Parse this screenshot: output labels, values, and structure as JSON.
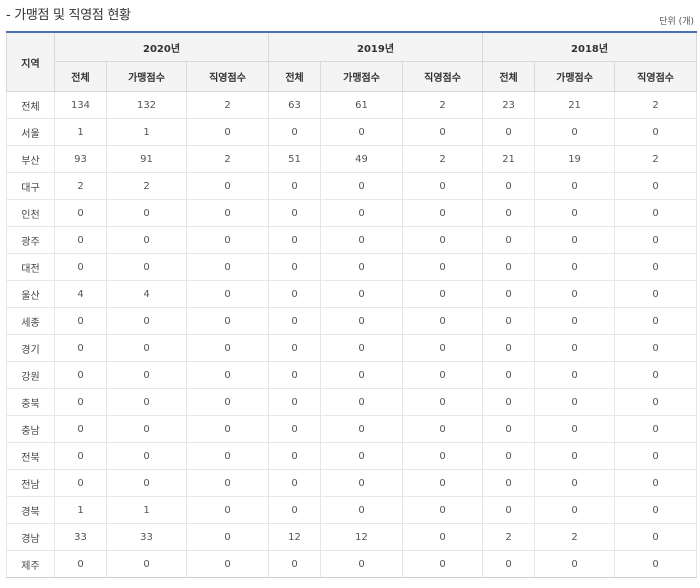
{
  "title": "- 가맹점 및 직영점 현황",
  "unit": "단위 (개)",
  "table": {
    "region_header": "지역",
    "years": [
      "2020년",
      "2019년",
      "2018년"
    ],
    "subheaders": [
      "전체",
      "가맹점수",
      "직영점수"
    ],
    "rows": [
      {
        "region": "전체",
        "values": [
          "134",
          "132",
          "2",
          "63",
          "61",
          "2",
          "23",
          "21",
          "2"
        ]
      },
      {
        "region": "서울",
        "values": [
          "1",
          "1",
          "0",
          "0",
          "0",
          "0",
          "0",
          "0",
          "0"
        ]
      },
      {
        "region": "부산",
        "values": [
          "93",
          "91",
          "2",
          "51",
          "49",
          "2",
          "21",
          "19",
          "2"
        ]
      },
      {
        "region": "대구",
        "values": [
          "2",
          "2",
          "0",
          "0",
          "0",
          "0",
          "0",
          "0",
          "0"
        ]
      },
      {
        "region": "인천",
        "values": [
          "0",
          "0",
          "0",
          "0",
          "0",
          "0",
          "0",
          "0",
          "0"
        ]
      },
      {
        "region": "광주",
        "values": [
          "0",
          "0",
          "0",
          "0",
          "0",
          "0",
          "0",
          "0",
          "0"
        ]
      },
      {
        "region": "대전",
        "values": [
          "0",
          "0",
          "0",
          "0",
          "0",
          "0",
          "0",
          "0",
          "0"
        ]
      },
      {
        "region": "울산",
        "values": [
          "4",
          "4",
          "0",
          "0",
          "0",
          "0",
          "0",
          "0",
          "0"
        ]
      },
      {
        "region": "세종",
        "values": [
          "0",
          "0",
          "0",
          "0",
          "0",
          "0",
          "0",
          "0",
          "0"
        ]
      },
      {
        "region": "경기",
        "values": [
          "0",
          "0",
          "0",
          "0",
          "0",
          "0",
          "0",
          "0",
          "0"
        ]
      },
      {
        "region": "강원",
        "values": [
          "0",
          "0",
          "0",
          "0",
          "0",
          "0",
          "0",
          "0",
          "0"
        ]
      },
      {
        "region": "충북",
        "values": [
          "0",
          "0",
          "0",
          "0",
          "0",
          "0",
          "0",
          "0",
          "0"
        ]
      },
      {
        "region": "충남",
        "values": [
          "0",
          "0",
          "0",
          "0",
          "0",
          "0",
          "0",
          "0",
          "0"
        ]
      },
      {
        "region": "전북",
        "values": [
          "0",
          "0",
          "0",
          "0",
          "0",
          "0",
          "0",
          "0",
          "0"
        ]
      },
      {
        "region": "전남",
        "values": [
          "0",
          "0",
          "0",
          "0",
          "0",
          "0",
          "0",
          "0",
          "0"
        ]
      },
      {
        "region": "경북",
        "values": [
          "1",
          "1",
          "0",
          "0",
          "0",
          "0",
          "0",
          "0",
          "0"
        ]
      },
      {
        "region": "경남",
        "values": [
          "33",
          "33",
          "0",
          "12",
          "12",
          "0",
          "2",
          "2",
          "0"
        ]
      },
      {
        "region": "제주",
        "values": [
          "0",
          "0",
          "0",
          "0",
          "0",
          "0",
          "0",
          "0",
          "0"
        ]
      }
    ]
  }
}
